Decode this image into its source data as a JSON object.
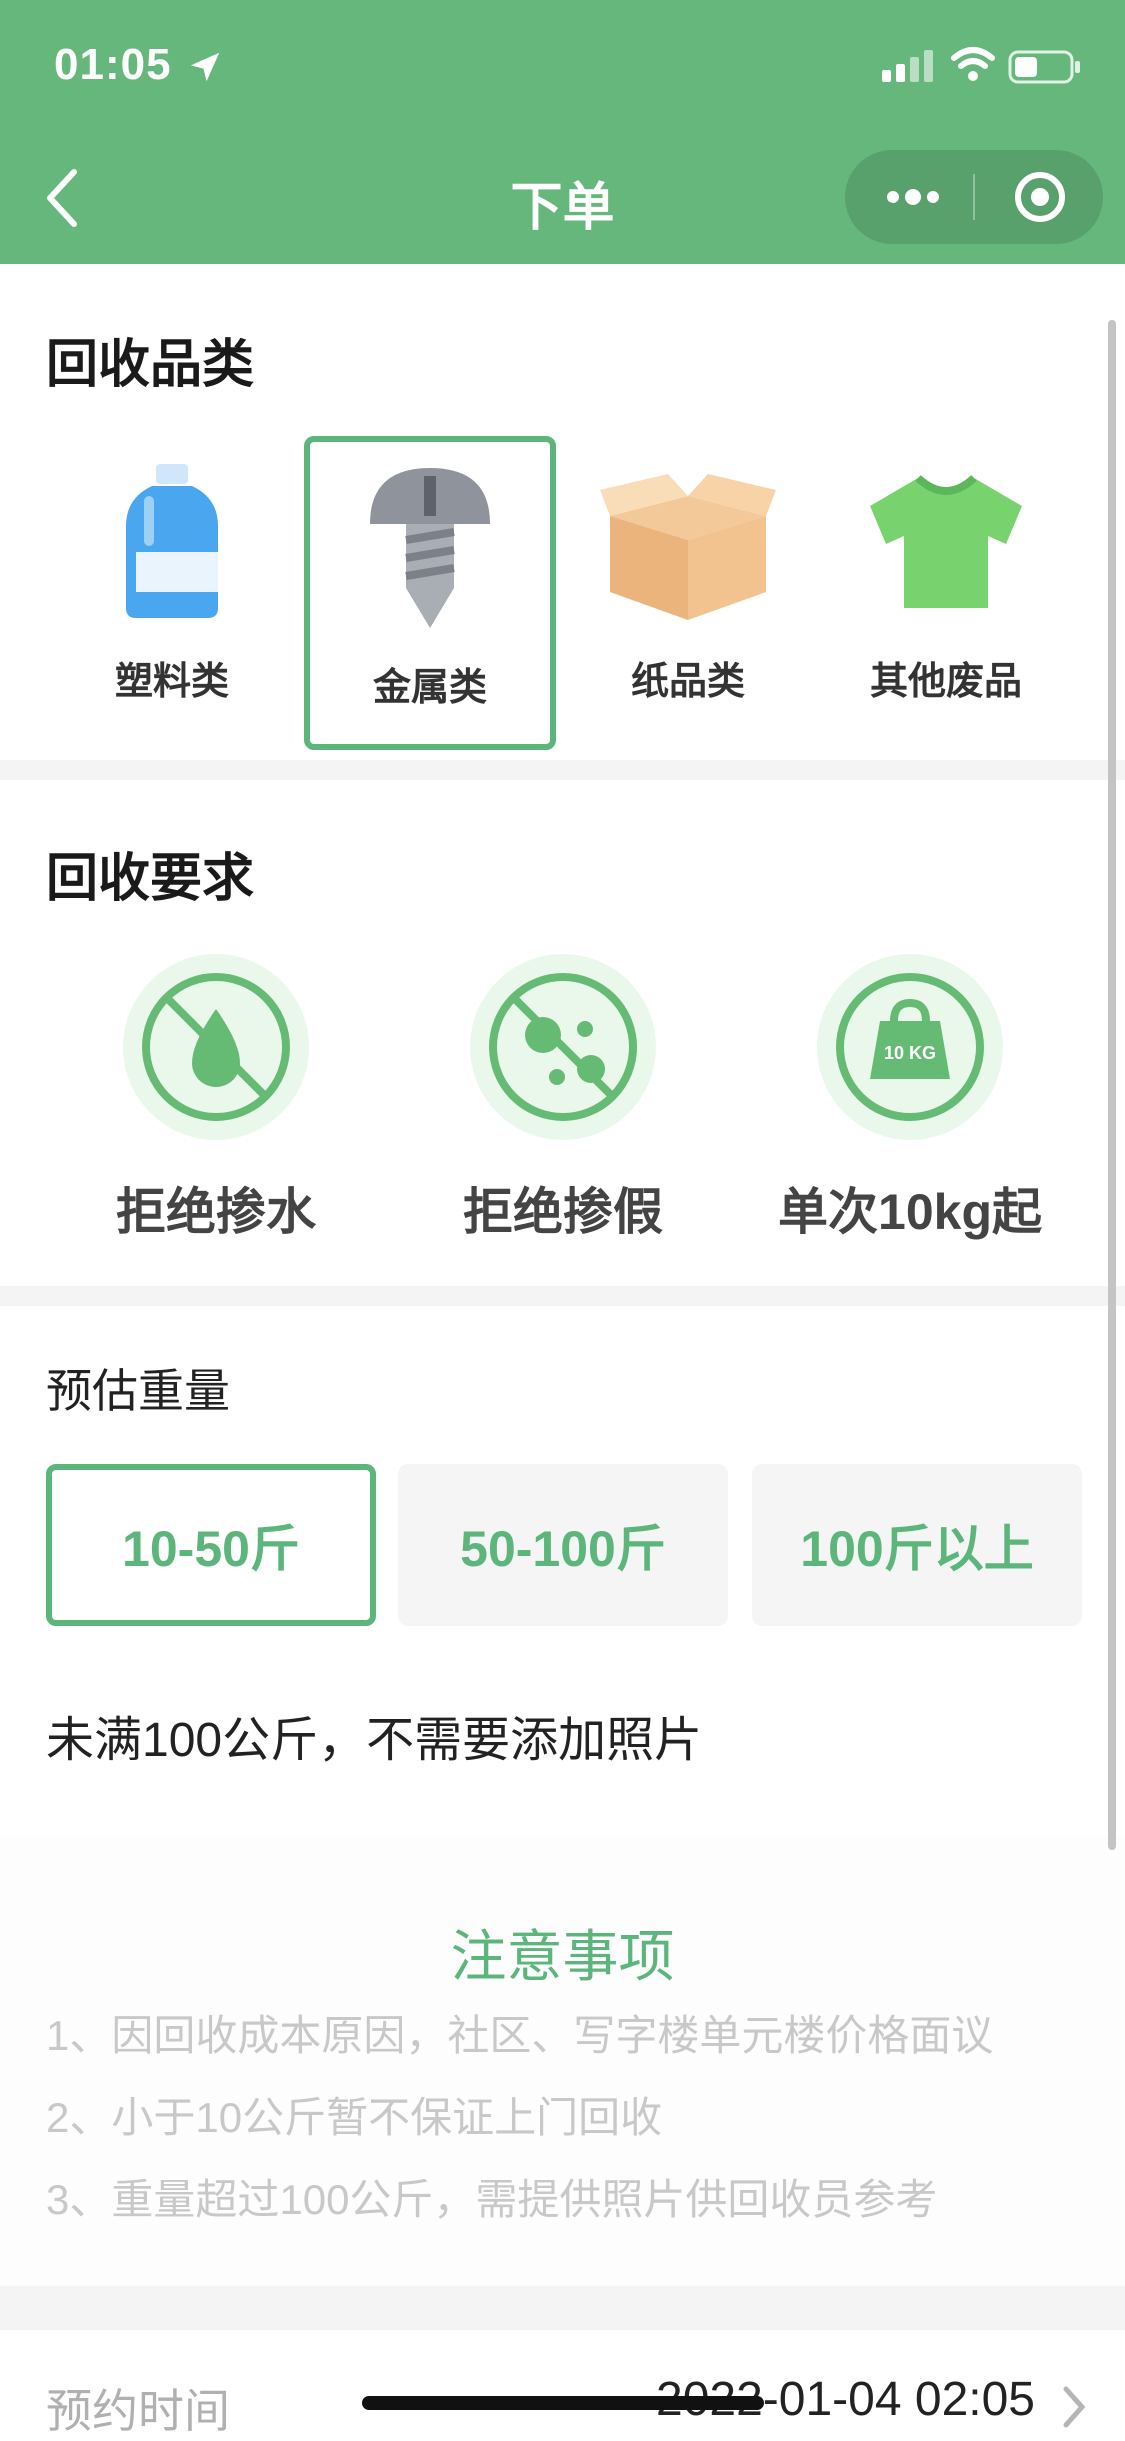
{
  "status_bar": {
    "time": "01:05"
  },
  "nav": {
    "title": "下单"
  },
  "colors": {
    "brand": "#65b77c",
    "accent": "#5cb67c",
    "notice_text": "#c8c8c8"
  },
  "categories": {
    "title": "回收品类",
    "items": [
      {
        "label": "塑料类",
        "icon": "plastic-bottle-icon",
        "selected": false
      },
      {
        "label": "金属类",
        "icon": "screw-icon",
        "selected": true
      },
      {
        "label": "纸品类",
        "icon": "cardboard-box-icon",
        "selected": false
      },
      {
        "label": "其他废品",
        "icon": "tshirt-icon",
        "selected": false
      }
    ]
  },
  "requirements": {
    "title": "回收要求",
    "items": [
      {
        "label": "拒绝掺水",
        "icon": "no-water-icon"
      },
      {
        "label": "拒绝掺假",
        "icon": "no-impurity-icon"
      },
      {
        "label": "单次10kg起",
        "icon": "weight-10kg-icon",
        "badge": "10 KG"
      }
    ]
  },
  "weight": {
    "title": "预估重量",
    "options": [
      {
        "label": "10-50斤",
        "selected": true
      },
      {
        "label": "50-100斤",
        "selected": false
      },
      {
        "label": "100斤以上",
        "selected": false
      }
    ],
    "photo_note": "未满100公斤，不需要添加照片"
  },
  "notice": {
    "title": "注意事项",
    "items": [
      "1、因回收成本原因，社区、写字楼单元楼价格面议",
      "2、小于10公斤暂不保证上门回收",
      "3、重量超过100公斤，需提供照片供回收员参考"
    ]
  },
  "appointment": {
    "label": "预约时间",
    "value": "2022-01-04 02:05"
  }
}
